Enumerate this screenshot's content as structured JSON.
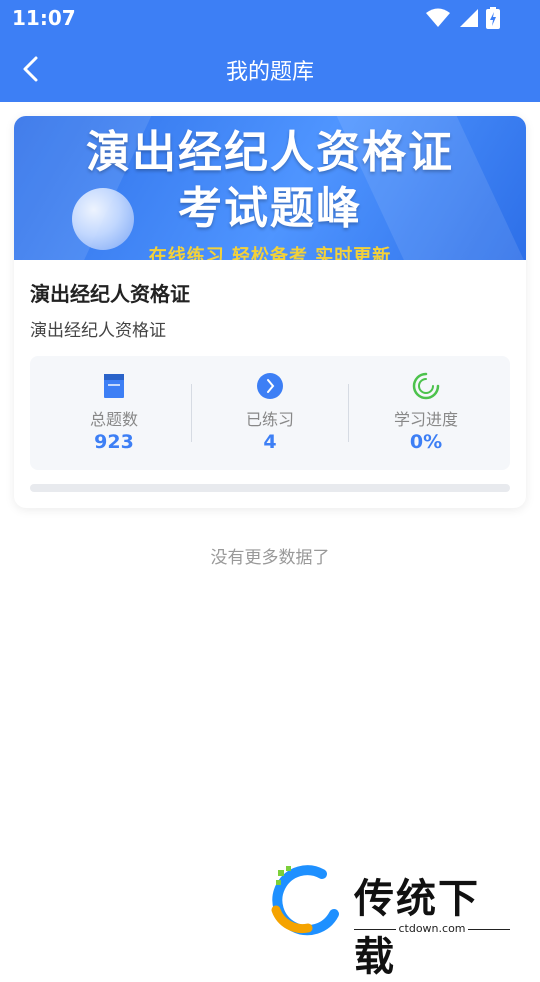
{
  "status_bar": {
    "time": "11:07"
  },
  "header": {
    "title": "我的题库"
  },
  "bank_card": {
    "banner": {
      "line1": "演出经纪人资格证",
      "line2": "考试题峰",
      "line3": "在线练习 轻松备考 实时更新"
    },
    "name": "演出经纪人资格证",
    "subtitle": "演出经纪人资格证",
    "stats": [
      {
        "icon": "book-icon",
        "label": "总题数",
        "value": "923"
      },
      {
        "icon": "arrow-circle-icon",
        "label": "已练习",
        "value": "4"
      },
      {
        "icon": "progress-ring-icon",
        "label": "学习进度",
        "value": "0%"
      }
    ],
    "progress_fraction": 0
  },
  "footer": {
    "no_more": "没有更多数据了"
  },
  "watermark": {
    "brand": "传统下载",
    "url": "ctdown.com"
  },
  "colors": {
    "accent": "#3d7ff5",
    "banner_yellow": "#f3d13a"
  }
}
